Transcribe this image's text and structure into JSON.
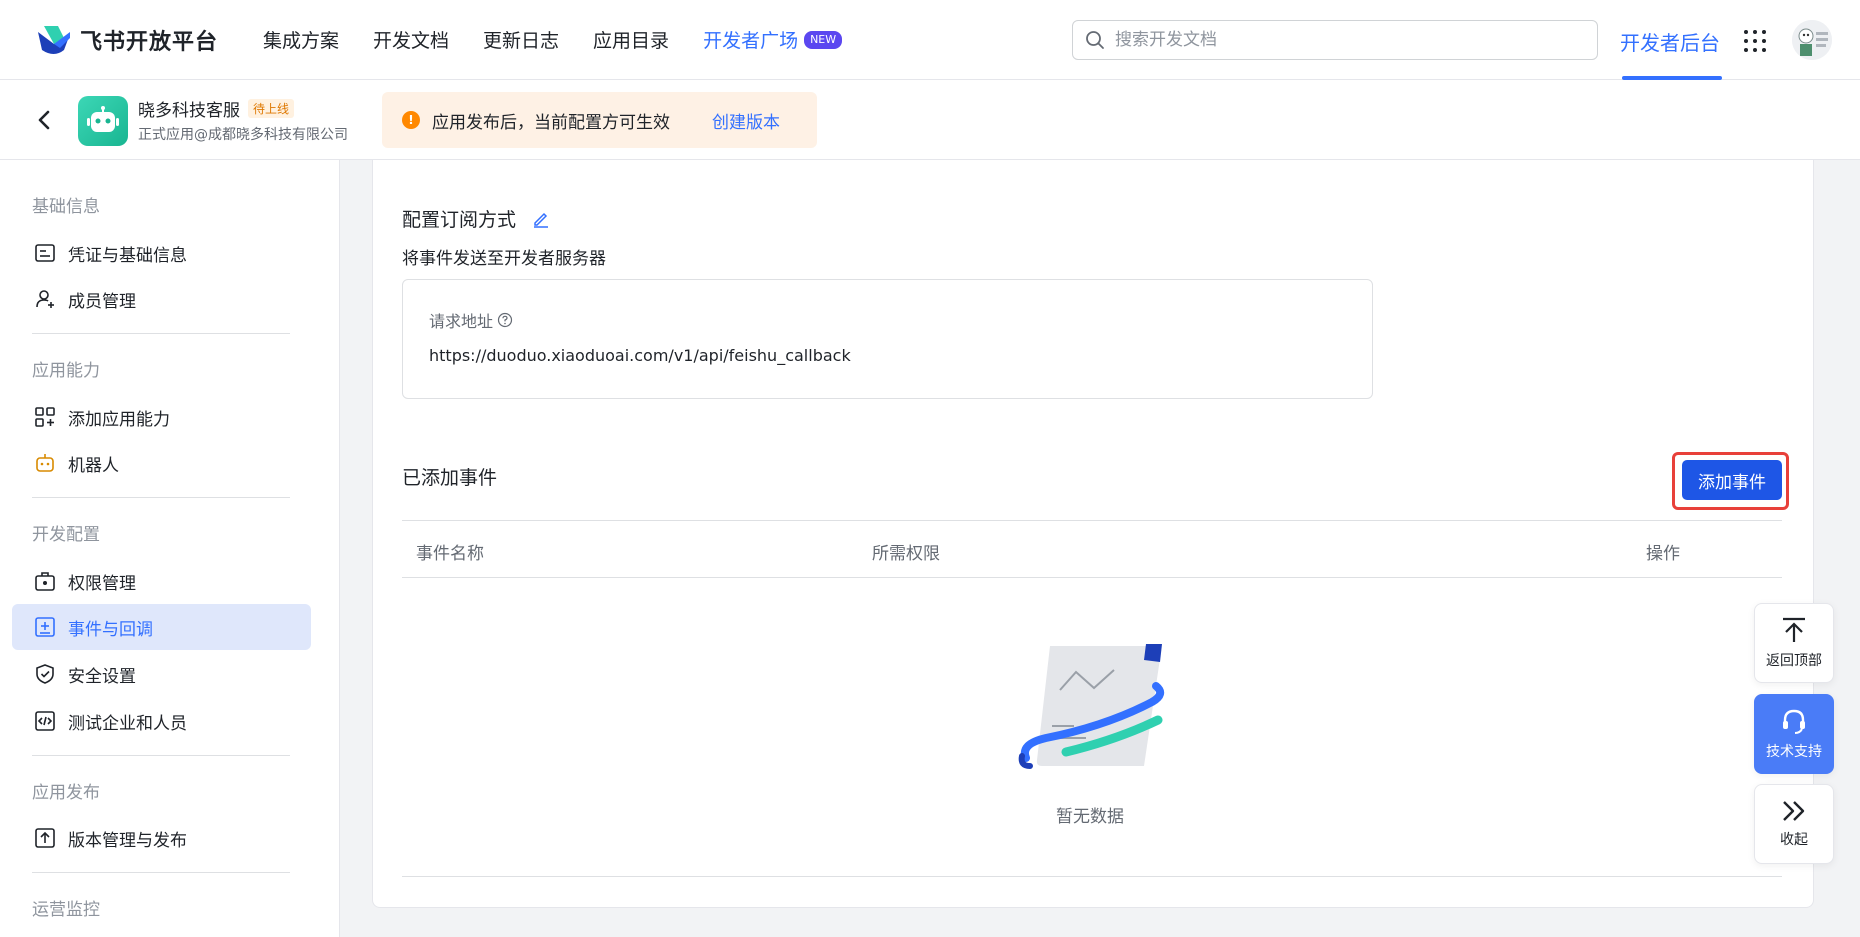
{
  "brand": {
    "name": "飞书开放平台"
  },
  "nav": {
    "items": [
      {
        "label": "集成方案"
      },
      {
        "label": "开发文档"
      },
      {
        "label": "更新日志"
      },
      {
        "label": "应用目录"
      }
    ],
    "plaza": {
      "label": "开发者广场",
      "badge": "NEW"
    },
    "search_placeholder": "搜索开发文档",
    "dev_console": "开发者后台"
  },
  "app": {
    "name": "晓多科技客服",
    "status": "待上线",
    "subtitle": "正式应用@成都晓多科技有限公司"
  },
  "notice": {
    "text": "应用发布后，当前配置方可生效",
    "link": "创建版本"
  },
  "sidebar": {
    "groups": [
      {
        "title": "基础信息",
        "items": [
          "凭证与基础信息",
          "成员管理"
        ]
      },
      {
        "title": "应用能力",
        "items": [
          "添加应用能力",
          "机器人"
        ]
      },
      {
        "title": "开发配置",
        "items": [
          "权限管理",
          "事件与回调",
          "安全设置",
          "测试企业和人员"
        ]
      },
      {
        "title": "应用发布",
        "items": [
          "版本管理与发布"
        ]
      },
      {
        "title": "运营监控",
        "items": []
      }
    ],
    "active_item": "事件与回调"
  },
  "subscription": {
    "title": "配置订阅方式",
    "description": "将事件发送至开发者服务器",
    "url_label": "请求地址",
    "url_value": "https://duoduo.xiaoduoai.com/v1/api/feishu_callback"
  },
  "events": {
    "title": "已添加事件",
    "add_button": "添加事件",
    "columns": [
      "事件名称",
      "所需权限",
      "操作"
    ],
    "empty_text": "暂无数据"
  },
  "floating": {
    "back_top": "返回顶部",
    "support": "技术支持",
    "collapse": "收起"
  },
  "colors": {
    "primary": "#3370ff",
    "button": "#1e56e6",
    "highlight_frame": "#e8403a",
    "notice_bg": "#fef1e5",
    "warning": "#ff8800"
  }
}
